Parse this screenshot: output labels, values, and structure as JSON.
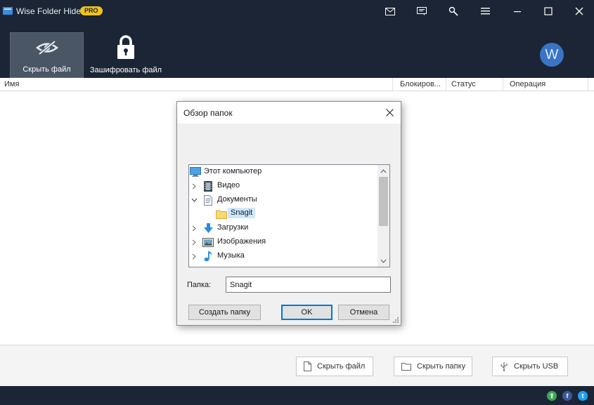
{
  "window": {
    "title": "Wise Folder Hider",
    "badge": "PRO"
  },
  "titlebar_icons": [
    "mail-icon",
    "feedback-icon",
    "tools-icon",
    "menu-icon",
    "minimize-icon",
    "maximize-icon",
    "close-icon"
  ],
  "toolbar": {
    "hide_file_label": "Скрыть файл",
    "encrypt_file_label": "Зашифровать файл",
    "avatar_letter": "W"
  },
  "columns": [
    "Имя",
    "Блокиров...",
    "Статус",
    "Операция"
  ],
  "dialog": {
    "title": "Обзор папок",
    "tree": [
      {
        "label": "Этот компьютер",
        "icon": "computer-icon",
        "expander": ""
      },
      {
        "label": "Видео",
        "icon": "video-icon",
        "expander": "collapsed"
      },
      {
        "label": "Документы",
        "icon": "documents-icon",
        "expander": "expanded"
      },
      {
        "label": "Snagit",
        "icon": "folder-icon",
        "expander": "",
        "selected": true
      },
      {
        "label": "Загрузки",
        "icon": "downloads-icon",
        "expander": "collapsed"
      },
      {
        "label": "Изображения",
        "icon": "pictures-icon",
        "expander": "collapsed"
      },
      {
        "label": "Музыка",
        "icon": "music-icon",
        "expander": "collapsed"
      }
    ],
    "folder_label": "Папка:",
    "folder_value": "Snagit",
    "create_folder_button": "Создать папку",
    "ok_button": "OK",
    "cancel_button": "Отмена"
  },
  "bottom_buttons": {
    "hide_file": "Скрыть файл",
    "hide_folder": "Скрыть папку",
    "hide_usb": "Скрыть USB"
  },
  "status_icons": [
    "share-icon",
    "facebook-icon",
    "twitter-icon"
  ],
  "colors": {
    "dark_bg": "#1b2535",
    "badge": "#f2c11b",
    "selection": "#cce8ff",
    "accent": "#0078d7"
  }
}
